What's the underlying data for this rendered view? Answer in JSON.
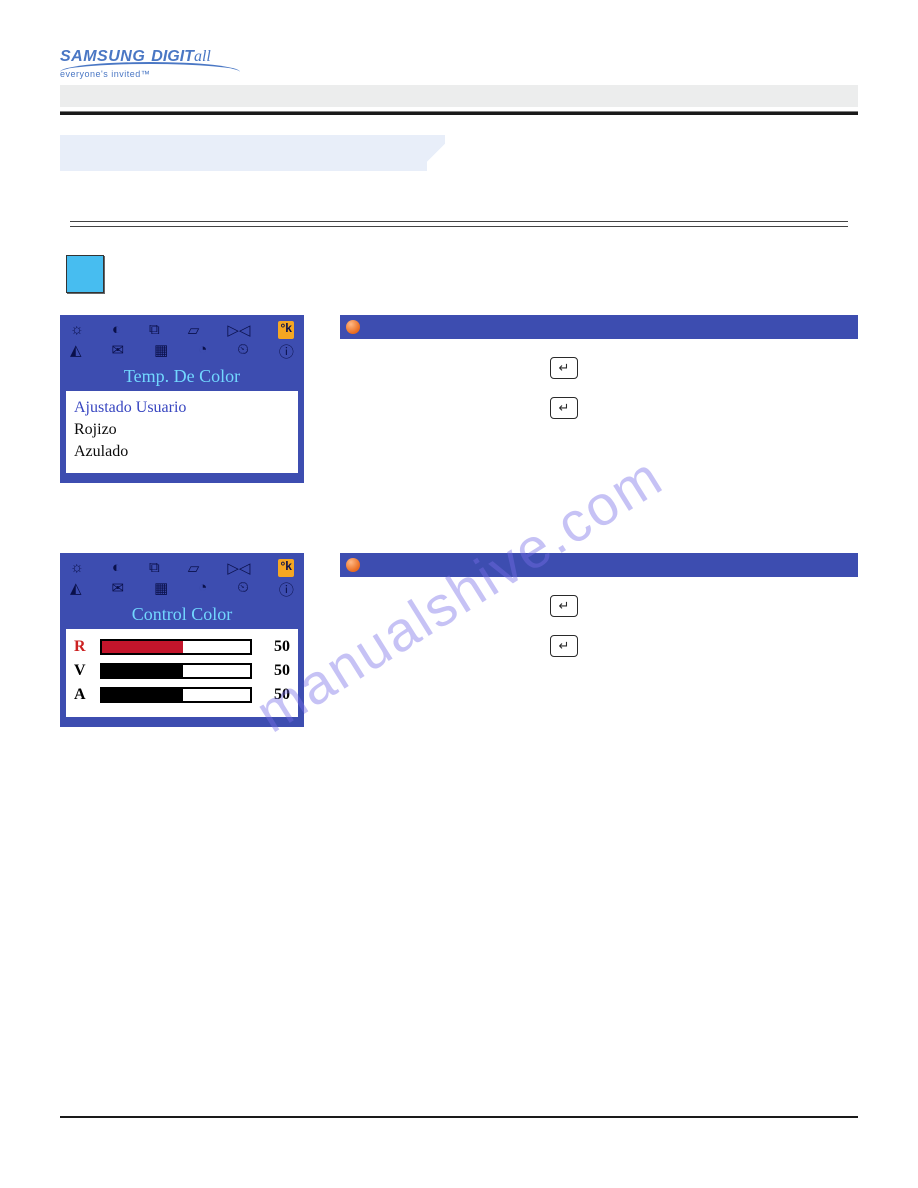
{
  "logo": {
    "brand": "SAMSUNG",
    "sub1": "DIGIT",
    "sub2": "all",
    "tagline": "everyone's invited™"
  },
  "watermark": "manualshive.com",
  "osd1": {
    "title": "Temp. De Color",
    "hl_icon": "°k",
    "options": [
      "Ajustado Usuario",
      "Rojizo",
      "Azulado"
    ]
  },
  "osd2": {
    "title": "Control Color",
    "hl_icon": "°k",
    "rows": [
      {
        "label": "R",
        "value": "50"
      },
      {
        "label": "V",
        "value": "50"
      },
      {
        "label": "A",
        "value": "50"
      }
    ]
  },
  "enter": "↵"
}
